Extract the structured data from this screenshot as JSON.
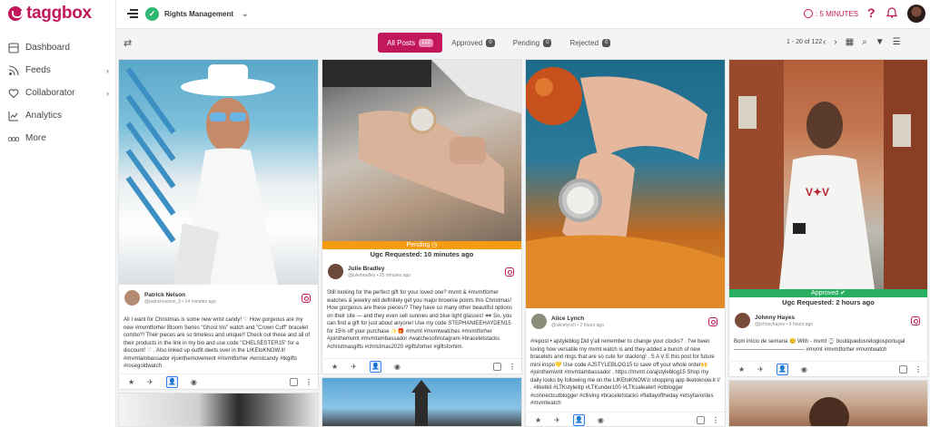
{
  "app": {
    "logo_text": "taggbox",
    "brand_color": "#c2185b"
  },
  "sidebar": {
    "items": [
      {
        "label": "Dashboard",
        "icon": "dashboard-icon",
        "has_chevron": false
      },
      {
        "label": "Feeds",
        "icon": "feeds-icon",
        "has_chevron": true
      },
      {
        "label": "Collaborator",
        "icon": "collaborator-icon",
        "has_chevron": true
      },
      {
        "label": "Analytics",
        "icon": "analytics-icon",
        "has_chevron": false
      },
      {
        "label": "More",
        "icon": "more-dots-icon",
        "has_chevron": false
      }
    ]
  },
  "header": {
    "workspace": "Rights Management",
    "timer_text": ": 5 MINUTES",
    "help_icon": "help-icon",
    "notification_icon": "bell-icon"
  },
  "toolbar": {
    "tabs": [
      {
        "label": "All Posts",
        "count": "122",
        "active": true
      },
      {
        "label": "Approved",
        "count": "0",
        "active": false
      },
      {
        "label": "Pending",
        "count": "0",
        "active": false
      },
      {
        "label": "Rejected",
        "count": "0",
        "active": false
      }
    ],
    "pager_text": "1 - 20 of 122"
  },
  "cards": [
    {
      "name": "Patrick Nelson",
      "handle": "@patricknelson_5 • 14 minutes ago",
      "text": "All I want for Christmas is some new wrist candy! ♡ How gorgeous are my new #mvmtforher Bloom Series \"Ghost Iris\" watch and \"Crown Cuff\" bracelet combo?! Their pieces are so timeless and unique!! Check out these and all of their products in the link in my bio and use code \"CHELSESTER15\" for a discount! ♡ . Also linked up outfit deets over in the LIKEtoKNOW.it! #mvmtambassador #jointhemovement #mvmtforher #wristcandy #tkgifts #rosegoldwatch"
    },
    {
      "name": "Julie Bradley",
      "handle": "@juliebradley • 25 minutes ago",
      "status": "Pending",
      "status_color": "#f39c12",
      "request": "Ugc Requested: 10 minutes ago",
      "text": "Still looking for the perfect gift for your loved one? mvmt & #mvmtforher watches & jewelry will definitely get you major brownie points this Christmas! How gorgeous are these pieces!? They have so many other beautiful options on their site — and they even sell sunnies and blue light glasses! 🕶 So, you can find a gift for just about anyone! Use my code STEPHANIEEHAYDEN15 for 15% off your purchase ✨🎁 #mvmt #mvmtwatches #mvmtforher #jointhemvmt #mvmtambassador #watchesofinstagram #braceletstacks #christmasgifts #christmas2020 #giftsforher #giftsforhim."
    },
    {
      "name": "Alice Lynch",
      "handle": "@alicelynch • 2 hours ago",
      "text": "#repost • ajstyleblog Did y'all remember to change your clocks? . I've been loving how versatile my mvmt watch is and they added a bunch of new bracelets and rings that are so cute for stacking! . S A V E this post for future mini inspo💛 Use code AJSTYLEBLOG15 to save off your whole order🙌 #jointhemvmt #mvmtambassador . https://mvmt.co/ajstyleblog15 Shop my daily looks by following me on the LIKEtoKNOW.it shopping app liketoknow.it // . #liketkit #LTKstyleitip #LTKunder100 #LTKsalealert #otblogger #connectcutblogger #ctliving #braceletstacks #flatlayoftheday #etsyfavorites #mvmtwatch"
    },
    {
      "name": "Johnny Hayes",
      "handle": "@johnnyhayes • 5 hours ago",
      "status": "Approved",
      "status_color": "#27ae60",
      "request": "Ugc Requested: 2 hours ago",
      "text": "Bom início de semana 😊 With - mvmt ⌚ boutiquedosrelogiosportugal ————————————— #mvmt #mvmtforher #mvmtwatch"
    },
    {
      "name": "",
      "handle": "",
      "text": ""
    },
    {
      "name": "",
      "handle": "",
      "text": ""
    },
    {
      "name": "",
      "handle": "",
      "text": ""
    }
  ]
}
